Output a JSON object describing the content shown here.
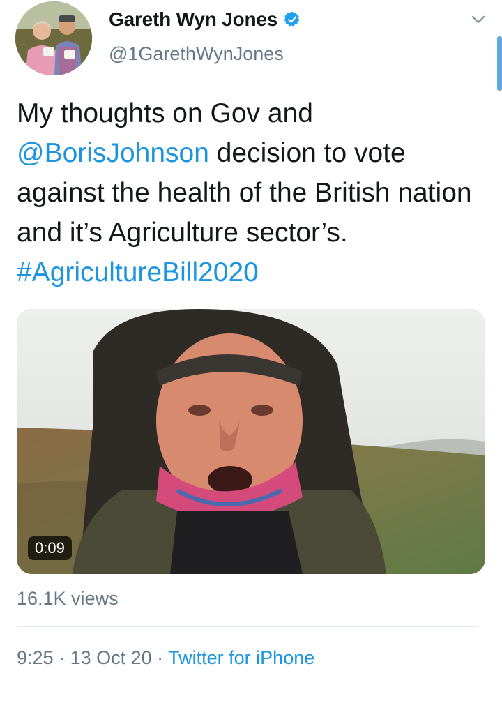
{
  "user": {
    "display_name": "Gareth Wyn Jones",
    "handle": "@1GarethWynJones",
    "verified": true
  },
  "tweet": {
    "text_1": "My thoughts on Gov and ",
    "mention": "@BorisJohnson",
    "text_2": " decision to vote against the health of the British nation and it’s Agriculture sector’s. ",
    "hashtag": "#AgricultureBill2020"
  },
  "media": {
    "duration": "0:09"
  },
  "stats": {
    "views": "16.1K views"
  },
  "meta": {
    "time": "9:25",
    "separator_1": " · ",
    "date": "13 Oct 20",
    "separator_2": " · ",
    "source": "Twitter for iPhone"
  },
  "icons": {
    "verified": "verified-badge-icon",
    "menu": "chevron-down-icon"
  },
  "colors": {
    "link": "#1b95e0",
    "secondary_text": "#657786",
    "divider": "#e1e8ed"
  }
}
